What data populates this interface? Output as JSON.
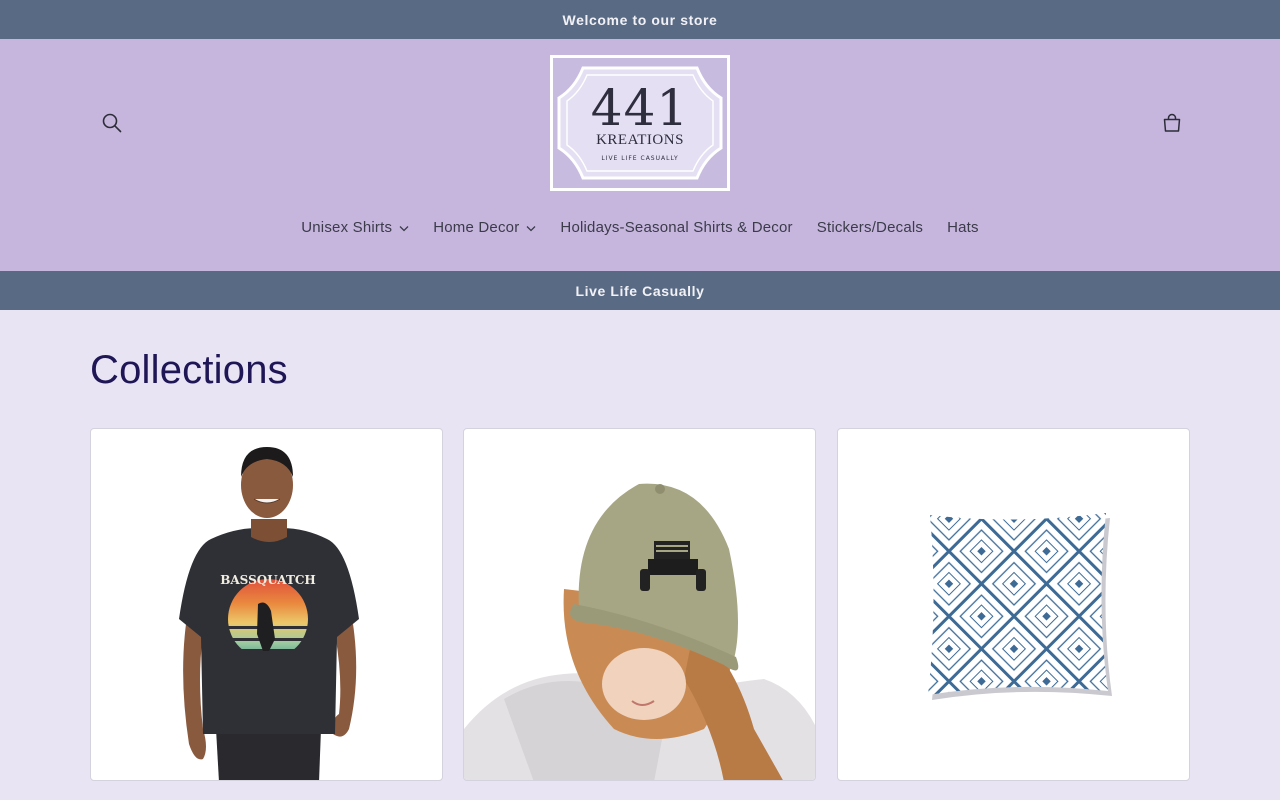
{
  "announcement_top": "Welcome to our store",
  "announcement_bottom": "Live Life Casually",
  "header": {
    "search_icon": "search-icon",
    "cart_icon": "cart-icon",
    "logo": {
      "number": "441",
      "name": "KREATIONS",
      "tagline": "LIVE LIFE CASUALLY"
    }
  },
  "nav": {
    "items": [
      {
        "label": "Unisex Shirts",
        "has_dropdown": true
      },
      {
        "label": "Home Decor",
        "has_dropdown": true
      },
      {
        "label": "Holidays-Seasonal Shirts & Decor",
        "has_dropdown": false
      },
      {
        "label": "Stickers/Decals",
        "has_dropdown": false
      },
      {
        "label": "Hats",
        "has_dropdown": false
      }
    ]
  },
  "main": {
    "title": "Collections",
    "collections": [
      {
        "image": "man-in-bassquatch-tshirt",
        "shirt_print": "BASSQUATCH"
      },
      {
        "image": "woman-in-jeep-cap"
      },
      {
        "image": "blue-diamond-pattern-pillow"
      }
    ]
  },
  "colors": {
    "announcement_bg": "#596a85",
    "header_bg": "#c6b6dd",
    "page_bg": "#e8e4f4",
    "title_color": "#1f1656"
  }
}
